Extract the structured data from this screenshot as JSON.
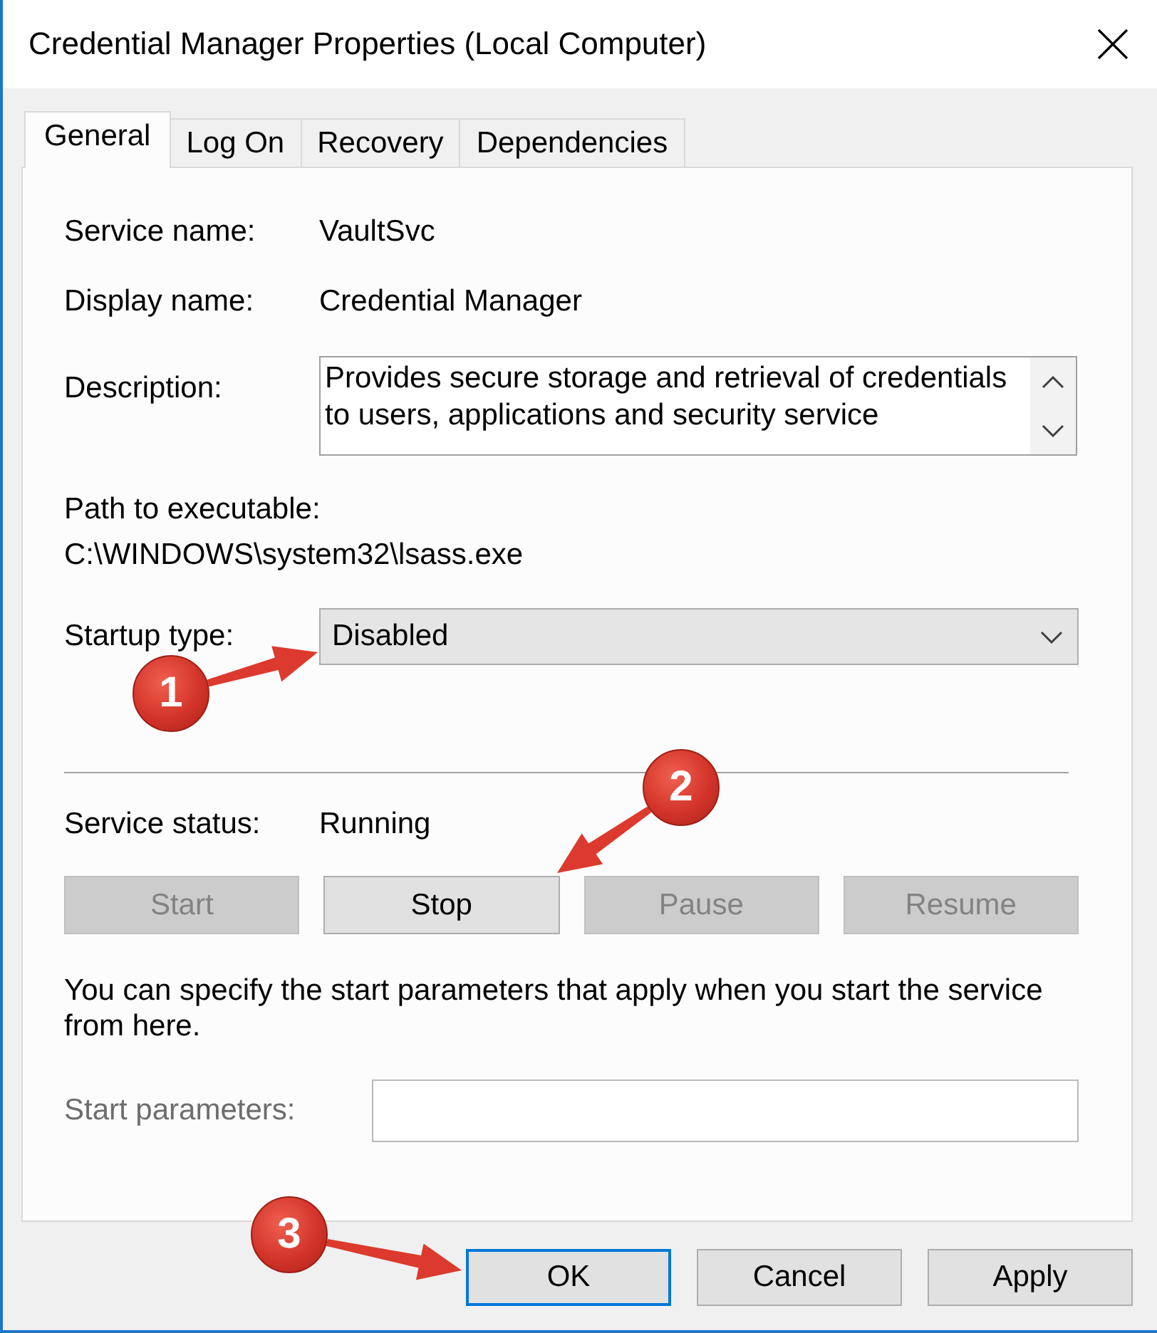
{
  "window": {
    "title": "Credential Manager Properties (Local Computer)"
  },
  "tabs": [
    {
      "label": "General",
      "selected": true
    },
    {
      "label": "Log On",
      "selected": false
    },
    {
      "label": "Recovery",
      "selected": false
    },
    {
      "label": "Dependencies",
      "selected": false
    }
  ],
  "general": {
    "service_name": {
      "label": "Service name:",
      "value": "VaultSvc"
    },
    "display_name": {
      "label": "Display name:",
      "value": "Credential Manager"
    },
    "description": {
      "label": "Description:",
      "value": "Provides secure storage and retrieval of credentials to users, applications and security service"
    },
    "path": {
      "label": "Path to executable:",
      "value": "C:\\WINDOWS\\system32\\lsass.exe"
    },
    "startup_type": {
      "label": "Startup type:",
      "value": "Disabled"
    },
    "service_status": {
      "label": "Service status:",
      "value": "Running"
    },
    "service_buttons": [
      {
        "label": "Start",
        "disabled": true
      },
      {
        "label": "Stop",
        "disabled": false
      },
      {
        "label": "Pause",
        "disabled": true
      },
      {
        "label": "Resume",
        "disabled": true
      }
    ],
    "note": "You can specify the start parameters that apply when you start the service from here.",
    "start_parameters": {
      "label": "Start parameters:",
      "disabled": true
    }
  },
  "buttons": [
    {
      "label": "OK",
      "focused": true
    },
    {
      "label": "Cancel",
      "focused": false
    },
    {
      "label": "Apply",
      "focused": false
    }
  ],
  "callouts": [
    {
      "number": "1"
    },
    {
      "number": "2"
    },
    {
      "number": "3"
    }
  ]
}
